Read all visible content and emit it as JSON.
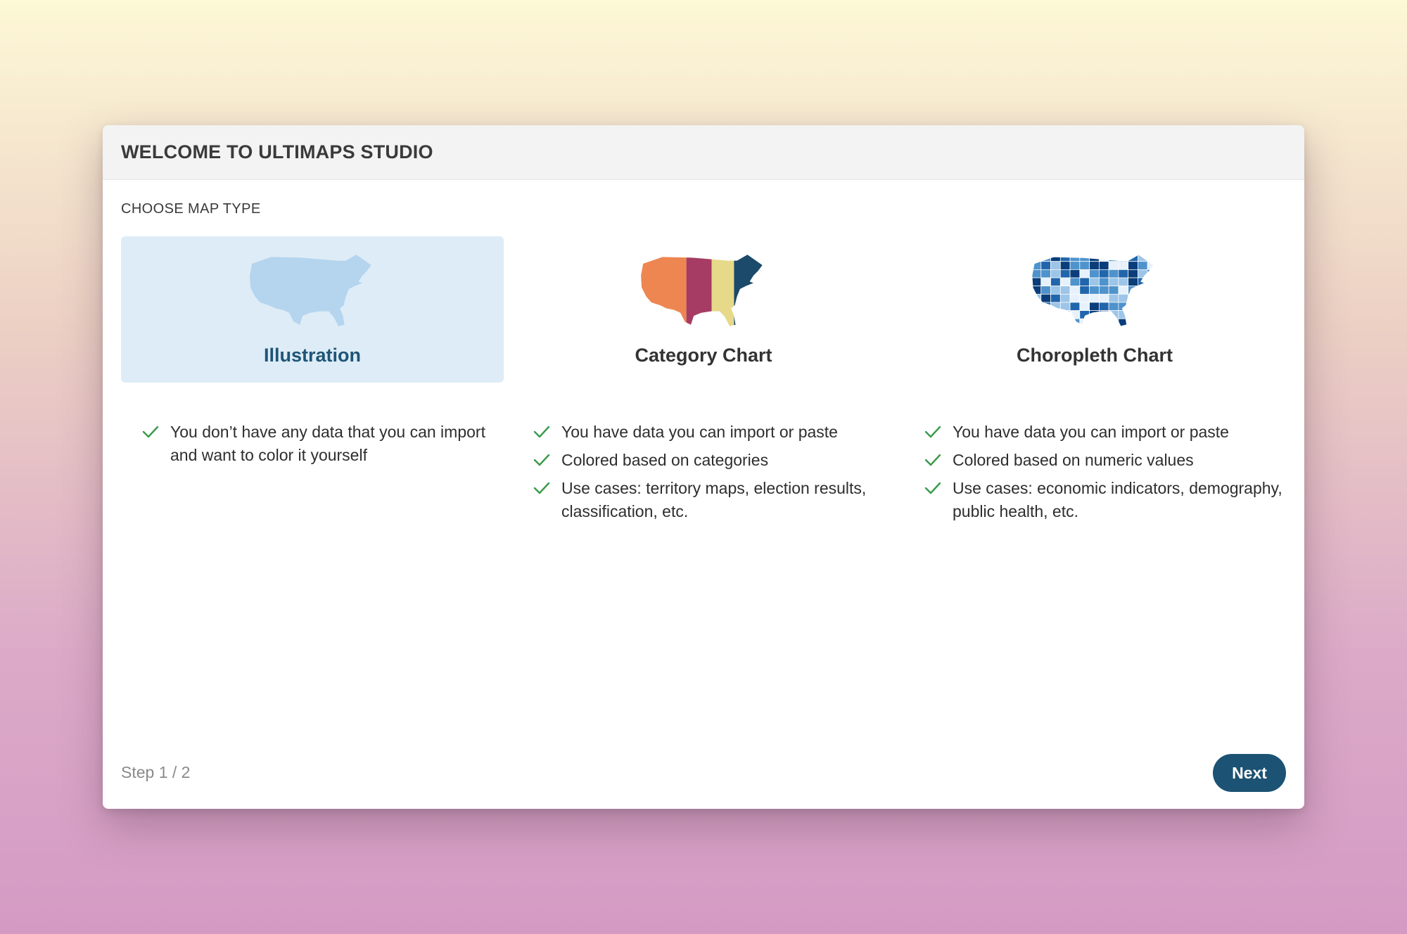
{
  "dialog": {
    "title": "WELCOME TO ULTIMAPS STUDIO",
    "section_label": "CHOOSE MAP TYPE"
  },
  "map_types": [
    {
      "label": "Illustration",
      "icon": "us-map-plain-icon",
      "selected": true,
      "features": [
        "You don’t have any data that you can import and want to color it yourself"
      ]
    },
    {
      "label": "Category Chart",
      "icon": "us-map-category-icon",
      "selected": false,
      "features": [
        "You have data you can import or paste",
        "Colored based on categories",
        "Use cases: territory maps, election results, classification, etc."
      ]
    },
    {
      "label": "Choropleth Chart",
      "icon": "us-map-choropleth-icon",
      "selected": false,
      "features": [
        "You have data you can import or paste",
        "Colored based on numeric values",
        "Use cases: economic indicators, demography, public health, etc."
      ]
    }
  ],
  "footer": {
    "step": "Step 1 / 2",
    "next_label": "Next"
  },
  "colors": {
    "accent": "#1c5273",
    "selected_bg": "#ddecf6",
    "check": "#3a9a4a",
    "illustration_map": "#b5d4ee",
    "category_map": [
      "#ee8652",
      "#a63c63",
      "#e6d98a",
      "#1b4a6a"
    ],
    "choropleth_map": [
      "#0a3d7a",
      "#2166ac",
      "#4f93cc",
      "#9cc5e8",
      "#e7f1fb"
    ]
  }
}
